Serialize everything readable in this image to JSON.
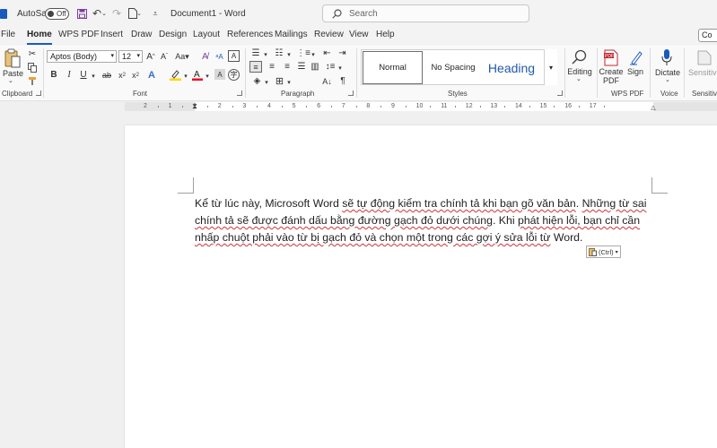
{
  "titlebar": {
    "autosave_label": "AutoSave",
    "autosave_state": "Off",
    "doc_title": "Document1 - Word",
    "search_placeholder": "Search"
  },
  "menu": {
    "tabs": [
      "File",
      "Home",
      "WPS PDF",
      "Insert",
      "Draw",
      "Design",
      "Layout",
      "References",
      "Mailings",
      "Review",
      "View",
      "Help"
    ],
    "active": "Home",
    "comments_label": "Co"
  },
  "ribbon": {
    "clipboard": {
      "paste_label": "Paste",
      "group_label": "Clipboard"
    },
    "font": {
      "font_name": "Aptos (Body)",
      "font_size": "12",
      "group_label": "Font"
    },
    "paragraph": {
      "group_label": "Paragraph"
    },
    "styles": {
      "items": [
        "Normal",
        "No Spacing",
        "Heading"
      ],
      "selected": "Normal",
      "group_label": "Styles"
    },
    "editing": {
      "label": "Editing"
    },
    "wps": {
      "create_label": "Create PDF",
      "create_line1": "Create",
      "create_line2": "PDF",
      "sign_label": "Sign",
      "group_label": "WPS PDF"
    },
    "voice": {
      "dictate_label": "Dictate",
      "group_label": "Voice"
    },
    "sensitivity": {
      "label": "Sensitivi",
      "group_label": "Sensitivity"
    }
  },
  "ruler": {
    "numbers": [
      "2",
      "1",
      "1",
      "2",
      "3",
      "4",
      "5",
      "6",
      "7",
      "8",
      "9",
      "10",
      "11",
      "12",
      "13",
      "14",
      "15",
      "16",
      "17"
    ]
  },
  "document": {
    "line1_a": "Kể từ lúc này, Microsoft Word ",
    "line1_b": "sẽ tự động kiểm tra chính tả khi bạn gõ văn bản",
    "line1_c": ". ",
    "line1_d": "Những từ sai",
    "line2_a": "chính tả sẽ được đánh dấu bằng đường gạch đỏ dưới chúng",
    "line2_b": ". Khi ",
    "line2_c": "phát hiện lỗi, bạn chỉ cần",
    "line3_a": "nhấp chuột phải vào từ bị gạch đỏ và chọn một trong các gợi ý sửa lỗi từ",
    "line3_b": " Word."
  },
  "paste_options": {
    "label": "(Ctrl)"
  },
  "colors": {
    "accent": "#185abd",
    "spell_underline": "#d13438",
    "highlight": "#ffd400",
    "font_color": "#e81123"
  },
  "icons": [
    "word-icon",
    "save-icon",
    "undo-icon",
    "redo-icon",
    "new-doc-icon",
    "customize-icon",
    "search-icon",
    "paste-icon",
    "cut-icon",
    "copy-icon",
    "format-painter-icon",
    "bold-icon",
    "italic-icon",
    "underline-icon",
    "strikethrough-icon",
    "subscript-icon",
    "superscript-icon",
    "text-effects-icon",
    "highlight-icon",
    "font-color-icon",
    "bullets-icon",
    "numbering-icon",
    "multilevel-icon",
    "decrease-indent-icon",
    "increase-indent-icon",
    "align-left-icon",
    "align-center-icon",
    "align-right-icon",
    "justify-icon",
    "columns-icon",
    "line-spacing-icon",
    "shading-icon",
    "borders-icon",
    "sort-icon",
    "pilcrow-icon",
    "find-icon",
    "create-pdf-icon",
    "sign-icon",
    "microphone-icon",
    "sensitivity-icon",
    "clipboard-icon"
  ]
}
